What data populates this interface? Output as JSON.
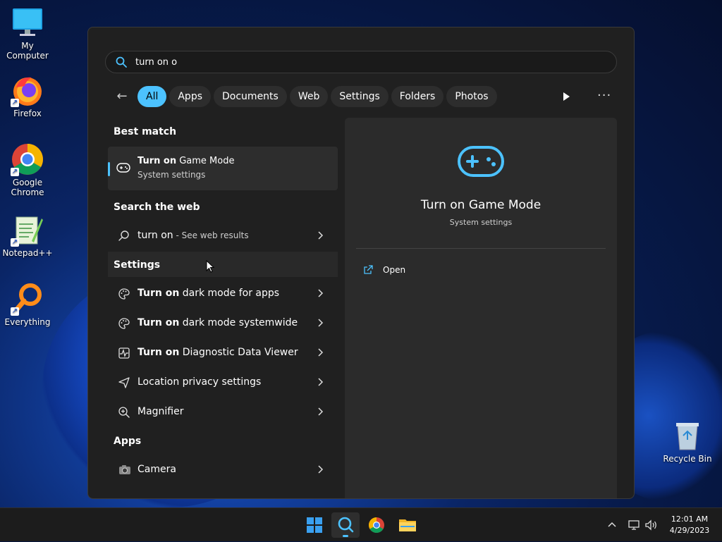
{
  "desktop": {
    "icons": [
      {
        "label": "My Computer",
        "icon": "monitor-icon"
      },
      {
        "label": "Firefox",
        "icon": "firefox-icon"
      },
      {
        "label": "Google Chrome",
        "icon": "chrome-icon"
      },
      {
        "label": "Notepad++",
        "icon": "notepadpp-icon"
      },
      {
        "label": "Everything",
        "icon": "everything-icon"
      }
    ],
    "recycle_bin": "Recycle Bin"
  },
  "search": {
    "query": "turn on o",
    "filters": [
      "All",
      "Apps",
      "Documents",
      "Web",
      "Settings",
      "Folders",
      "Photos"
    ],
    "active_filter": "All",
    "sections": {
      "best_match": "Best match",
      "search_web": "Search the web",
      "settings": "Settings",
      "apps": "Apps"
    },
    "best_match": {
      "bold": "Turn on",
      "rest": " Game Mode",
      "subtitle": "System settings"
    },
    "web": {
      "text": "turn on",
      "suffix": " - See web results"
    },
    "settings_results": [
      {
        "bold": "Turn on",
        "rest": " dark mode for apps",
        "icon": "palette-icon"
      },
      {
        "bold": "Turn on",
        "rest": " dark mode systemwide",
        "icon": "palette-icon"
      },
      {
        "bold": "Turn on",
        "rest": " Diagnostic Data Viewer",
        "icon": "diagnostic-icon"
      },
      {
        "bold": "",
        "rest": "Location privacy settings",
        "icon": "location-icon"
      },
      {
        "bold": "",
        "rest": "Magnifier",
        "icon": "magnifier-icon"
      }
    ],
    "apps_results": [
      {
        "label": "Camera",
        "icon": "camera-icon"
      }
    ]
  },
  "preview": {
    "title": "Turn on Game Mode",
    "subtitle": "System settings",
    "action": "Open"
  },
  "taskbar": {
    "time": "12:01 AM",
    "date": "4/29/2023"
  },
  "colors": {
    "accent": "#4cc2ff",
    "panel": "#202020"
  }
}
